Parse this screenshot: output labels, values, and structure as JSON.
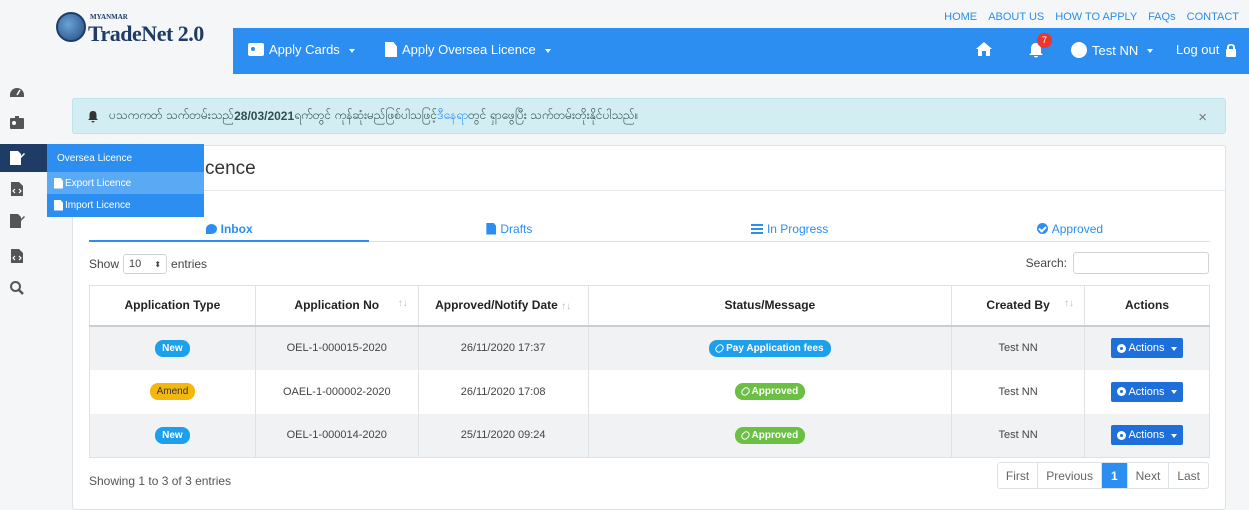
{
  "brand": {
    "small": "MYANMAR",
    "title": "TradeNet 2.0"
  },
  "top_links": [
    "HOME",
    "ABOUT US",
    "HOW TO APPLY",
    "FAQs",
    "CONTACT"
  ],
  "nav": {
    "apply_cards": "Apply Cards",
    "apply_oversea": "Apply Oversea Licence",
    "notification_count": "7",
    "user": "Test NN",
    "logout": "Log out"
  },
  "flyout": {
    "title": "Oversea Licence",
    "items": [
      "Export Licence",
      "Import Licence"
    ]
  },
  "alert": {
    "text_before": "ပသကကတ် သက်တမ်းသည် ",
    "date": "28/03/2021",
    "text_middle": " ရက်တွင် ကုန်ဆုံးမည်ဖြစ်ပါသဖြင့် ",
    "link": "ဒီနေရာ",
    "text_after": " တွင် ရှာဖွေပြီး သက်တမ်းတိုးနိုင်ပါသည်။",
    "close": "×"
  },
  "page_title": "cence",
  "tabs": [
    "Inbox",
    "Drafts",
    "In Progress",
    "Approved"
  ],
  "show": {
    "label_before": "Show",
    "value": "10",
    "label_after": "entries"
  },
  "search_label": "Search:",
  "table": {
    "headers": [
      "Application Type",
      "Application No",
      "Approved/Notify Date",
      "Status/Message",
      "Created By",
      "Actions"
    ],
    "rows": [
      {
        "type": "New",
        "no": "OEL-1-000015-2020",
        "date": "26/11/2020 17:37",
        "status": "Pay Application fees",
        "by": "Test NN",
        "action": "Actions"
      },
      {
        "type": "Amend",
        "no": "OAEL-1-000002-2020",
        "date": "26/11/2020 17:08",
        "status": "Approved",
        "by": "Test NN",
        "action": "Actions"
      },
      {
        "type": "New",
        "no": "OEL-1-000014-2020",
        "date": "25/11/2020 09:24",
        "status": "Approved",
        "by": "Test NN",
        "action": "Actions"
      }
    ]
  },
  "footer_info": "Showing 1 to 3 of 3 entries",
  "pager": [
    "First",
    "Previous",
    "1",
    "Next",
    "Last"
  ],
  "colors": {
    "primary": "#2b8ef0",
    "navy": "#1e3c66",
    "success": "#6bbf43",
    "warning": "#f3b70e",
    "danger": "#e8372c"
  },
  "icons": [
    "dashboard-icon",
    "id-card-icon",
    "edit-file-icon",
    "code-file-icon",
    "search-icon",
    "home-icon",
    "bell-icon",
    "user-icon",
    "lock-icon"
  ]
}
